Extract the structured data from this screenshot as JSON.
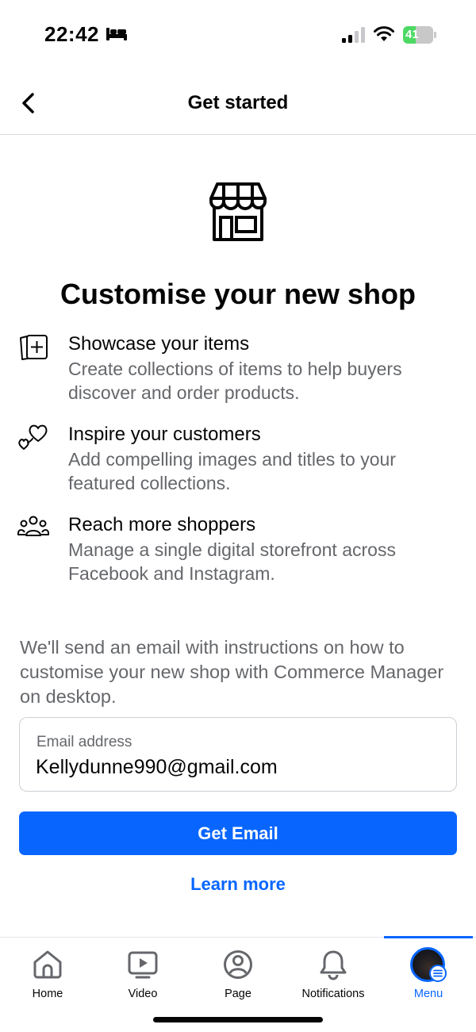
{
  "status_bar": {
    "time": "22:42",
    "battery_level": "41",
    "battery_fraction": 0.41,
    "icons": [
      "bed-icon",
      "signal-icon",
      "wifi-icon",
      "battery-icon"
    ]
  },
  "header": {
    "title": "Get started",
    "back_icon": "chevron-left-icon"
  },
  "hero": {
    "icon": "shop-icon",
    "title": "Customise your new shop"
  },
  "features": [
    {
      "icon": "add-collection-icon",
      "title": "Showcase your items",
      "description": "Create collections of items to help buyers discover and order products."
    },
    {
      "icon": "hearts-icon",
      "title": "Inspire your customers",
      "description": "Add compelling images and titles to your featured collections."
    },
    {
      "icon": "people-icon",
      "title": "Reach more shoppers",
      "description": "Manage a single digital storefront across Facebook and Instagram."
    }
  ],
  "info_text": "We'll send an email with instructions on how to customise your new shop with Commerce Manager on desktop.",
  "email_field": {
    "label": "Email address",
    "value": "Kellydunne990@gmail.com"
  },
  "primary_button": "Get Email",
  "learn_more": "Learn more",
  "bottom_nav": {
    "items": [
      {
        "label": "Home",
        "icon": "home-icon",
        "active": false
      },
      {
        "label": "Video",
        "icon": "video-icon",
        "active": false
      },
      {
        "label": "Page",
        "icon": "page-icon",
        "active": false
      },
      {
        "label": "Notifications",
        "icon": "bell-icon",
        "active": false
      },
      {
        "label": "Menu",
        "icon": "avatar",
        "active": true
      }
    ]
  },
  "colors": {
    "accent": "#0866ff",
    "secondary_text": "#65676b",
    "primary_text": "#050505",
    "battery": "#4cd964"
  }
}
